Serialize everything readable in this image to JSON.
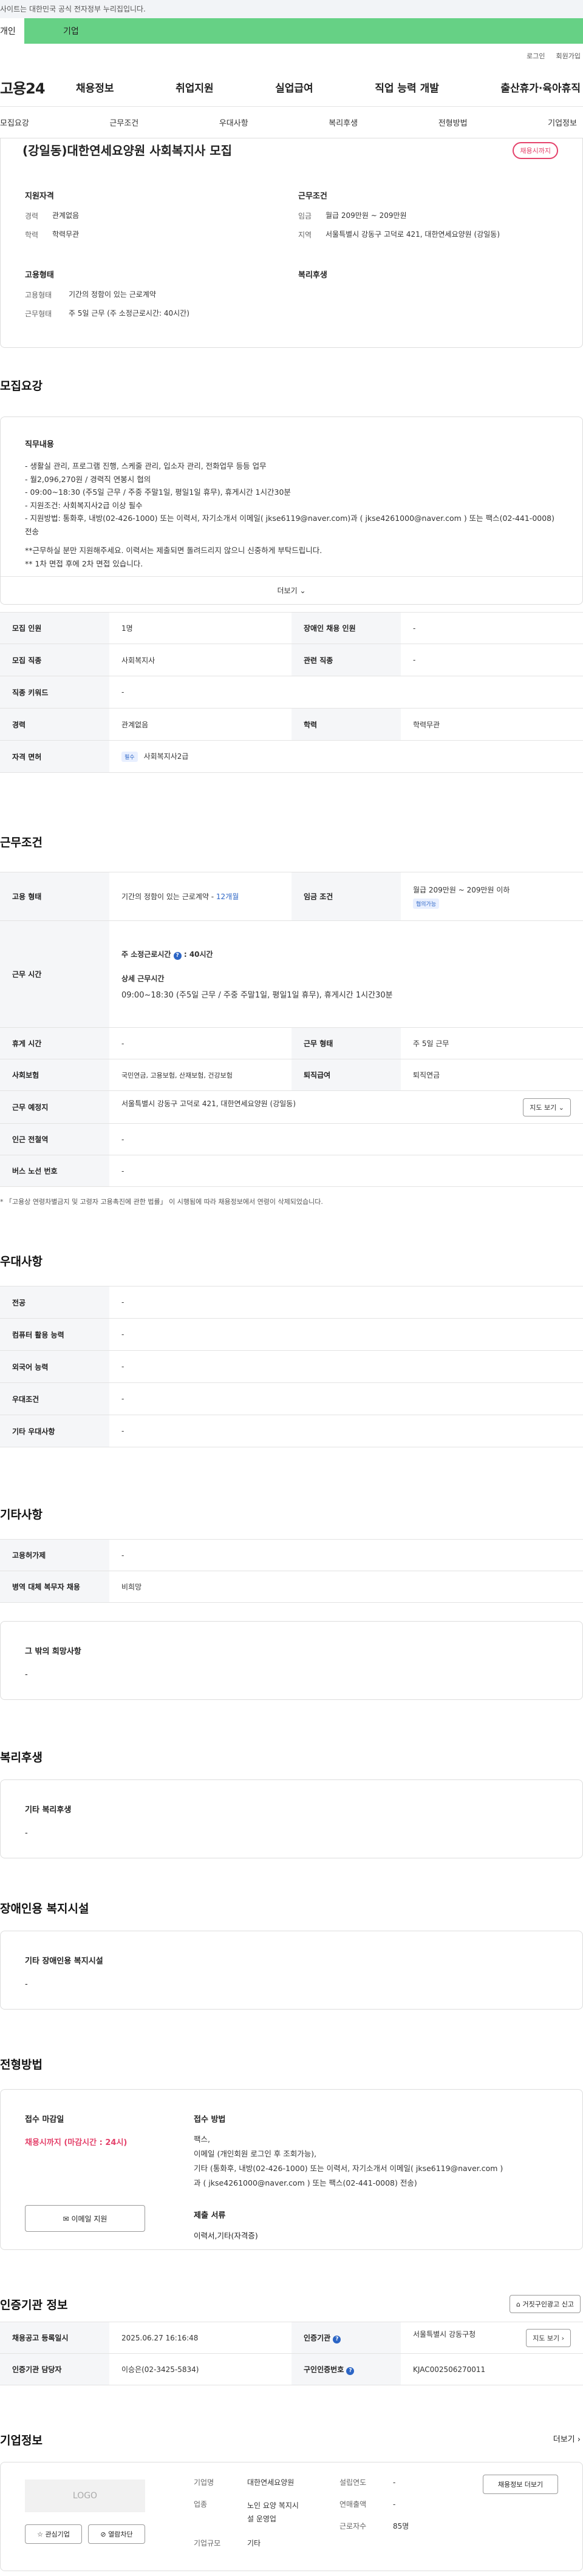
{
  "gov_banner": "사이트는 대한민국 공식 전자정부 누리집입니다.",
  "user_tabs": {
    "person": "개인",
    "corp": "기업"
  },
  "topbar": {
    "login": "로그인",
    "join": "회원가입"
  },
  "gnb": {
    "logo": "고용24",
    "menu": [
      "채용정보",
      "취업지원",
      "실업급여",
      "직업 능력 개발",
      "출산휴가·육아휴직"
    ]
  },
  "subnav": [
    "모집요강",
    "근무조건",
    "우대사항",
    "복리후생",
    "전형방법",
    "기업정보"
  ],
  "summary": {
    "title": "(강일동)대한연세요양원 사회복지사 모집",
    "status": "채용시까지",
    "qualification_h": "지원자격",
    "career_k": "경력",
    "career_v": "관계없음",
    "edu_k": "학력",
    "edu_v": "학력무관",
    "conditions_h": "근무조건",
    "wage_k": "임금",
    "wage_v": "월급 209만원 ~ 209만원",
    "region_k": "지역",
    "region_v": "서울특별시 강동구 고덕로 421, 대한연세요양원 (강일동)",
    "employ_h": "고용형태",
    "type_k": "고용형태",
    "type_v": "기간의 정함이 있는 근로계약",
    "shape_k": "근무형태",
    "shape_v": "주 5일 근무 (주 소정근로시간: 40시간)",
    "welfare_h": "복리후생"
  },
  "recruit": {
    "title": "모집요강",
    "desc_h": "직무내용",
    "desc_lines": [
      "- 생활실 관리, 프로그램 진행, 스케줄 관리, 입소자 관리, 전화업무 등등 업무",
      "- 월2,096,270원 / 경력직 연봉시 협의",
      "- 09:00~18:30 (주5일 근무 / 주중 주말1일, 평일1일 휴무), 휴게시간 1시간30분",
      "- 지원조건: 사회복지사2급 이상 필수",
      "- 지원방법: 통화후, 내방(02-426-1000) 또는 이력서, 자기소개서 이메일( jkse6119@naver.com)과 ( jkse4261000@naver.com ) 또는 팩스(02-441-0008) 전송",
      "",
      "**근무하실 분만 지원해주세요. 이력서는 제출되면 돌려드리지 않으니 신중하게 부탁드립니다.",
      "** 1차 면접 후에 2차 면접 있습니다."
    ],
    "more": "더보기",
    "rows": [
      {
        "k1": "모집 인원",
        "v1": "1명",
        "k2": "장애인 채용 인원",
        "v2": "-"
      },
      {
        "k1": "모집 직종",
        "v1": "사회복지사",
        "k2": "관련 직종",
        "v2": "-"
      },
      {
        "k1": "직종 키워드",
        "v1": "-"
      },
      {
        "k1": "경력",
        "v1": "관계없음",
        "k2": "학력",
        "v2": "학력무관"
      }
    ],
    "license_k": "자격 면허",
    "license_badge": "필수",
    "license_v": "사회복지사2급"
  },
  "conditions": {
    "title": "근무조건",
    "type_k": "고용 형태",
    "type_v": "기간의 정함이 있는 근로계약 -",
    "type_months": "12개월",
    "wage_k": "임금 조건",
    "wage_v": "월급 209만원 ~ 209만원 이하",
    "wage_badge": "협의가능",
    "hours_k": "근무 시간",
    "hours_line1": "주 소정근로시간",
    "hours_line1_v": ": 40시간",
    "hours_sub_h": "상세 근무시간",
    "hours_sub_v": "09:00~18:30 (주5일 근무 / 주중 주말1일, 평일1일 휴무), 휴게시간 1시간30분",
    "break_k": "휴게 시간",
    "break_v": "-",
    "shape_k": "근무 형태",
    "shape_v": "주 5일 근무",
    "ins_k": "사회보험",
    "ins_v": "국민연금, 고용보험, 산재보험, 건강보험",
    "sev_k": "퇴직급여",
    "sev_v": "퇴직연금",
    "place_k": "근무 예정지",
    "place_v": "서울특별시 강동구 고덕로 421, 대한연세요양원 (강일동)",
    "map_btn": "지도 보기",
    "station_k": "인근 전철역",
    "station_v": "-",
    "bus_k": "버스 노선 번호",
    "bus_v": "-",
    "note": "* 「고용상 연령차별금지 및 고령자 고용촉진에 관한 법률」 이 시행됨에 따라 채용정보에서 연령이 삭제되었습니다."
  },
  "preference": {
    "title": "우대사항",
    "rows": [
      {
        "k": "전공",
        "v": "-"
      },
      {
        "k": "컴퓨터 활용 능력",
        "v": "-"
      },
      {
        "k": "외국어 능력",
        "v": "-"
      },
      {
        "k": "우대조건",
        "v": "-"
      },
      {
        "k": "기타 우대사항",
        "v": "-"
      }
    ]
  },
  "etc": {
    "title": "기타사항",
    "rows": [
      {
        "k": "고용허가제",
        "v": "-"
      },
      {
        "k": "병역 대체 복무자 채용",
        "v": "비희망"
      }
    ],
    "box_h": "그 밖의 희망사항",
    "box_v": "-"
  },
  "welfare": {
    "title": "복리후생",
    "h": "기타 복리후생",
    "v": "-"
  },
  "disabled": {
    "title": "장애인용 복지시설",
    "h": "기타 장애인용 복지시설",
    "v": "-"
  },
  "apply": {
    "title": "전형방법",
    "deadline_h": "접수 마감일",
    "deadline_v": "채용시까지 (마감시간 : 24시)",
    "email_btn": "이메일 지원",
    "method_h": "접수 방법",
    "method_lines": [
      "팩스,",
      "이메일 (개인회원 로그인 후 조회가능),",
      "기타 (통화후, 내방(02-426-1000) 또는 이력서, 자기소개서 이메일( jkse6119@naver.com )",
      "과 ( jkse4261000@naver.com ) 또는 팩스(02-441-0008) 전송)"
    ],
    "docs_h": "제출 서류",
    "docs_v": "이력서,기타(자격증)"
  },
  "cert": {
    "title": "인증기관 정보",
    "report_btn": "거짓구인광고 신고",
    "reg_k": "채용공고 등록일시",
    "reg_v": "2025.06.27 16:16:48",
    "org_k": "인증기관",
    "org_v": "서울특별시 강동구청",
    "map_btn": "지도 보기",
    "mgr_k": "인증기관 담당자",
    "mgr_v": "이승은(02-3425-5834)",
    "id_k": "구인인증번호",
    "id_v": "KJAC002506270011"
  },
  "company": {
    "title": "기업정보",
    "more": "더보기",
    "logo": "LOGO",
    "fav_btn": "관심기업",
    "block_btn": "열람차단",
    "name_k": "기업명",
    "name_v": "대한연세요양원",
    "biz_k": "업종",
    "biz_v1": "노인 요양 복지시",
    "biz_v2": "설 운영업",
    "size_k": "기업규모",
    "size_v": "기타",
    "found_k": "설립연도",
    "found_v": "-",
    "sales_k": "연매출액",
    "sales_v": "-",
    "staff_k": "근로자수",
    "staff_v": "85명",
    "jobs_btn": "채용정보 더보기"
  }
}
